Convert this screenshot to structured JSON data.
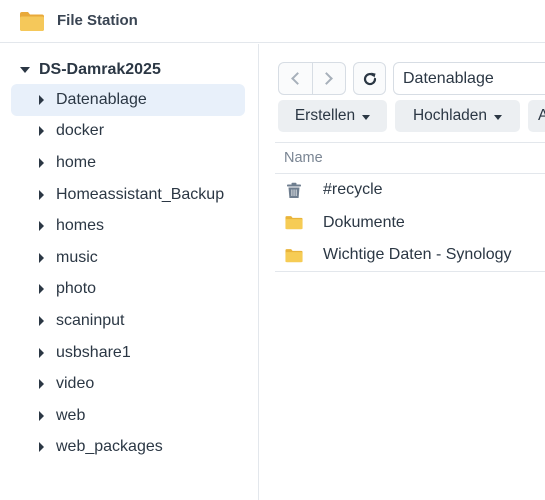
{
  "app": {
    "title": "File Station",
    "icon": "folder-icon"
  },
  "sidebar": {
    "root_label": "DS-Damrak2025",
    "items": [
      {
        "label": "Datenablage",
        "selected": true
      },
      {
        "label": "docker"
      },
      {
        "label": "home"
      },
      {
        "label": "Homeassistant_Backup"
      },
      {
        "label": "homes"
      },
      {
        "label": "music"
      },
      {
        "label": "photo"
      },
      {
        "label": "scaninput"
      },
      {
        "label": "usbshare1"
      },
      {
        "label": "video"
      },
      {
        "label": "web"
      },
      {
        "label": "web_packages"
      }
    ]
  },
  "toolbar": {
    "back_icon": "chevron-left-icon",
    "forward_icon": "chevron-right-icon",
    "refresh_icon": "refresh-icon",
    "path_value": "Datenablage",
    "create_label": "Erstellen",
    "upload_label": "Hochladen",
    "more_label": "A"
  },
  "filelist": {
    "column_name": "Name",
    "rows": [
      {
        "label": "#recycle",
        "icon": "trash-icon"
      },
      {
        "label": "Dokumente",
        "icon": "folder-icon"
      },
      {
        "label": "Wichtige Daten - Synology",
        "icon": "folder-icon"
      }
    ]
  },
  "colors": {
    "selected_bg": "#e8f0fa",
    "folder": "#f2c94c",
    "text": "#2b3744",
    "muted": "#7a8593"
  }
}
